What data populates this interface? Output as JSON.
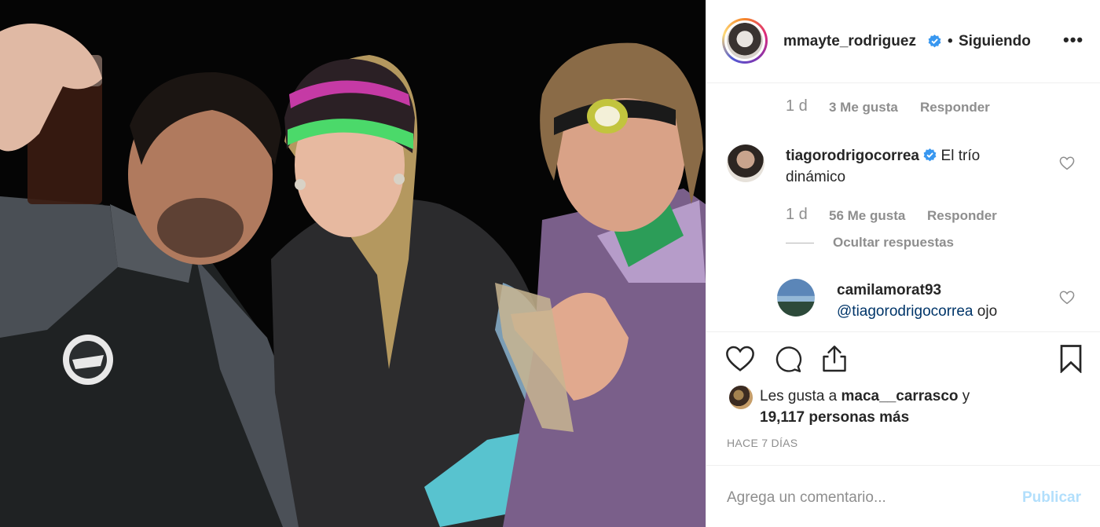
{
  "post": {
    "username": "mmayte_rodriguez",
    "verified": true,
    "separator": "•",
    "follow_status": "Siguiendo",
    "more_label": "•••"
  },
  "comments": [
    {
      "time": "1 d",
      "likes": "3 Me gusta",
      "reply_label": "Responder"
    },
    {
      "username": "tiagorodrigocorrea",
      "verified": true,
      "text_line1": "El trío",
      "text_line2": "dinámico",
      "time": "1 d",
      "likes": "56 Me gusta",
      "reply_label": "Responder",
      "hide_replies": "Ocultar respuestas"
    },
    {
      "username": "camilamorat93",
      "mention": "@tiagorodrigocorrea",
      "text": "ojo"
    }
  ],
  "likes": {
    "prefix": "Les gusta a",
    "first_user": "maca__carrasco",
    "conjunction": "y",
    "count_text": "19,117 personas más"
  },
  "posted_ago": "HACE 7 DÍAS",
  "add_comment": {
    "placeholder": "Agrega un comentario...",
    "post_label": "Publicar"
  },
  "icons": {
    "like": "heart-icon",
    "comment": "comment-icon",
    "share": "share-icon",
    "save": "bookmark-icon",
    "verified": "verified-badge-icon",
    "more": "more-options-icon"
  },
  "colors": {
    "verified": "#3897f0",
    "mention": "#003569",
    "muted": "#8e8e8e",
    "publish_disabled": "#b2dffc"
  }
}
